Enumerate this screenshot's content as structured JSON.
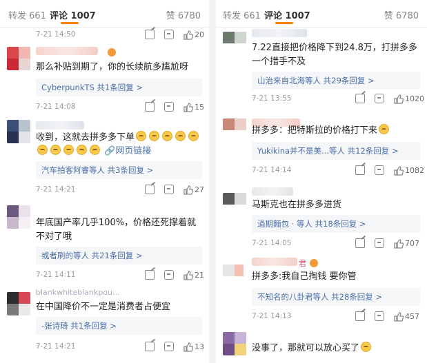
{
  "left": {
    "tabs": {
      "repost": "转发 661",
      "comments": "评论 1007",
      "likes": "赞 6780"
    },
    "top_meta": {
      "time": "7-21 14:50",
      "likes": "20"
    },
    "comments": [
      {
        "text": "那么补贴到期了，你的长续航多尴尬呀",
        "reply": "CyberpunkTS  共1条回复 >",
        "time": "7-21 14:08",
        "likes": "15"
      },
      {
        "text_line1": "收到，这就去拼多多下单",
        "link": "网页链接",
        "reply": "汽车拍客阿睿等人  共3条回复 >",
        "time": "7-21 14:21",
        "likes": "27"
      },
      {
        "text": "年底国产率几乎100%，价格还死撑着就不对了哦",
        "reply": "或者刷的等人  共21条回复 >",
        "time": "7-21 14:11",
        "likes": "21"
      },
      {
        "name": "blankwhiteblankpou...",
        "text": "在中国降价不一定是消费者占便宜",
        "reply": "-张诗琦  共1条回复 >",
        "time": "7-21 14:21",
        "likes": "13"
      }
    ]
  },
  "right": {
    "tabs": {
      "repost": "转发 661",
      "comments": "评论 1007",
      "likes": "赞 6780"
    },
    "comments": [
      {
        "text": "7.22直接把价格降下到24.8万，打拼多多一个措手不及",
        "reply": "山治来自北海等人  共29条回复 >",
        "time": "7-21 13:55",
        "likes": "1020"
      },
      {
        "text": "拼多多：把特斯拉的价格打下来",
        "reply": "Yukikina并不是美...等人  共12条回复 >",
        "time": "7-21 14:14",
        "likes": "1082"
      },
      {
        "text": "马斯克也在拼多多进货",
        "reply": "過期麵包 · 等人  共18条回复 >",
        "time": "7-21 14:05",
        "likes": "707"
      },
      {
        "name_suffix": "君",
        "text": "拼多多:我自己掏钱 要你管",
        "reply": "不知名的八卦君等人  共28条回复 >",
        "time": "7-21 14:13",
        "likes": "457"
      },
      {
        "text": "没事了，那就可以放心买了"
      }
    ]
  }
}
